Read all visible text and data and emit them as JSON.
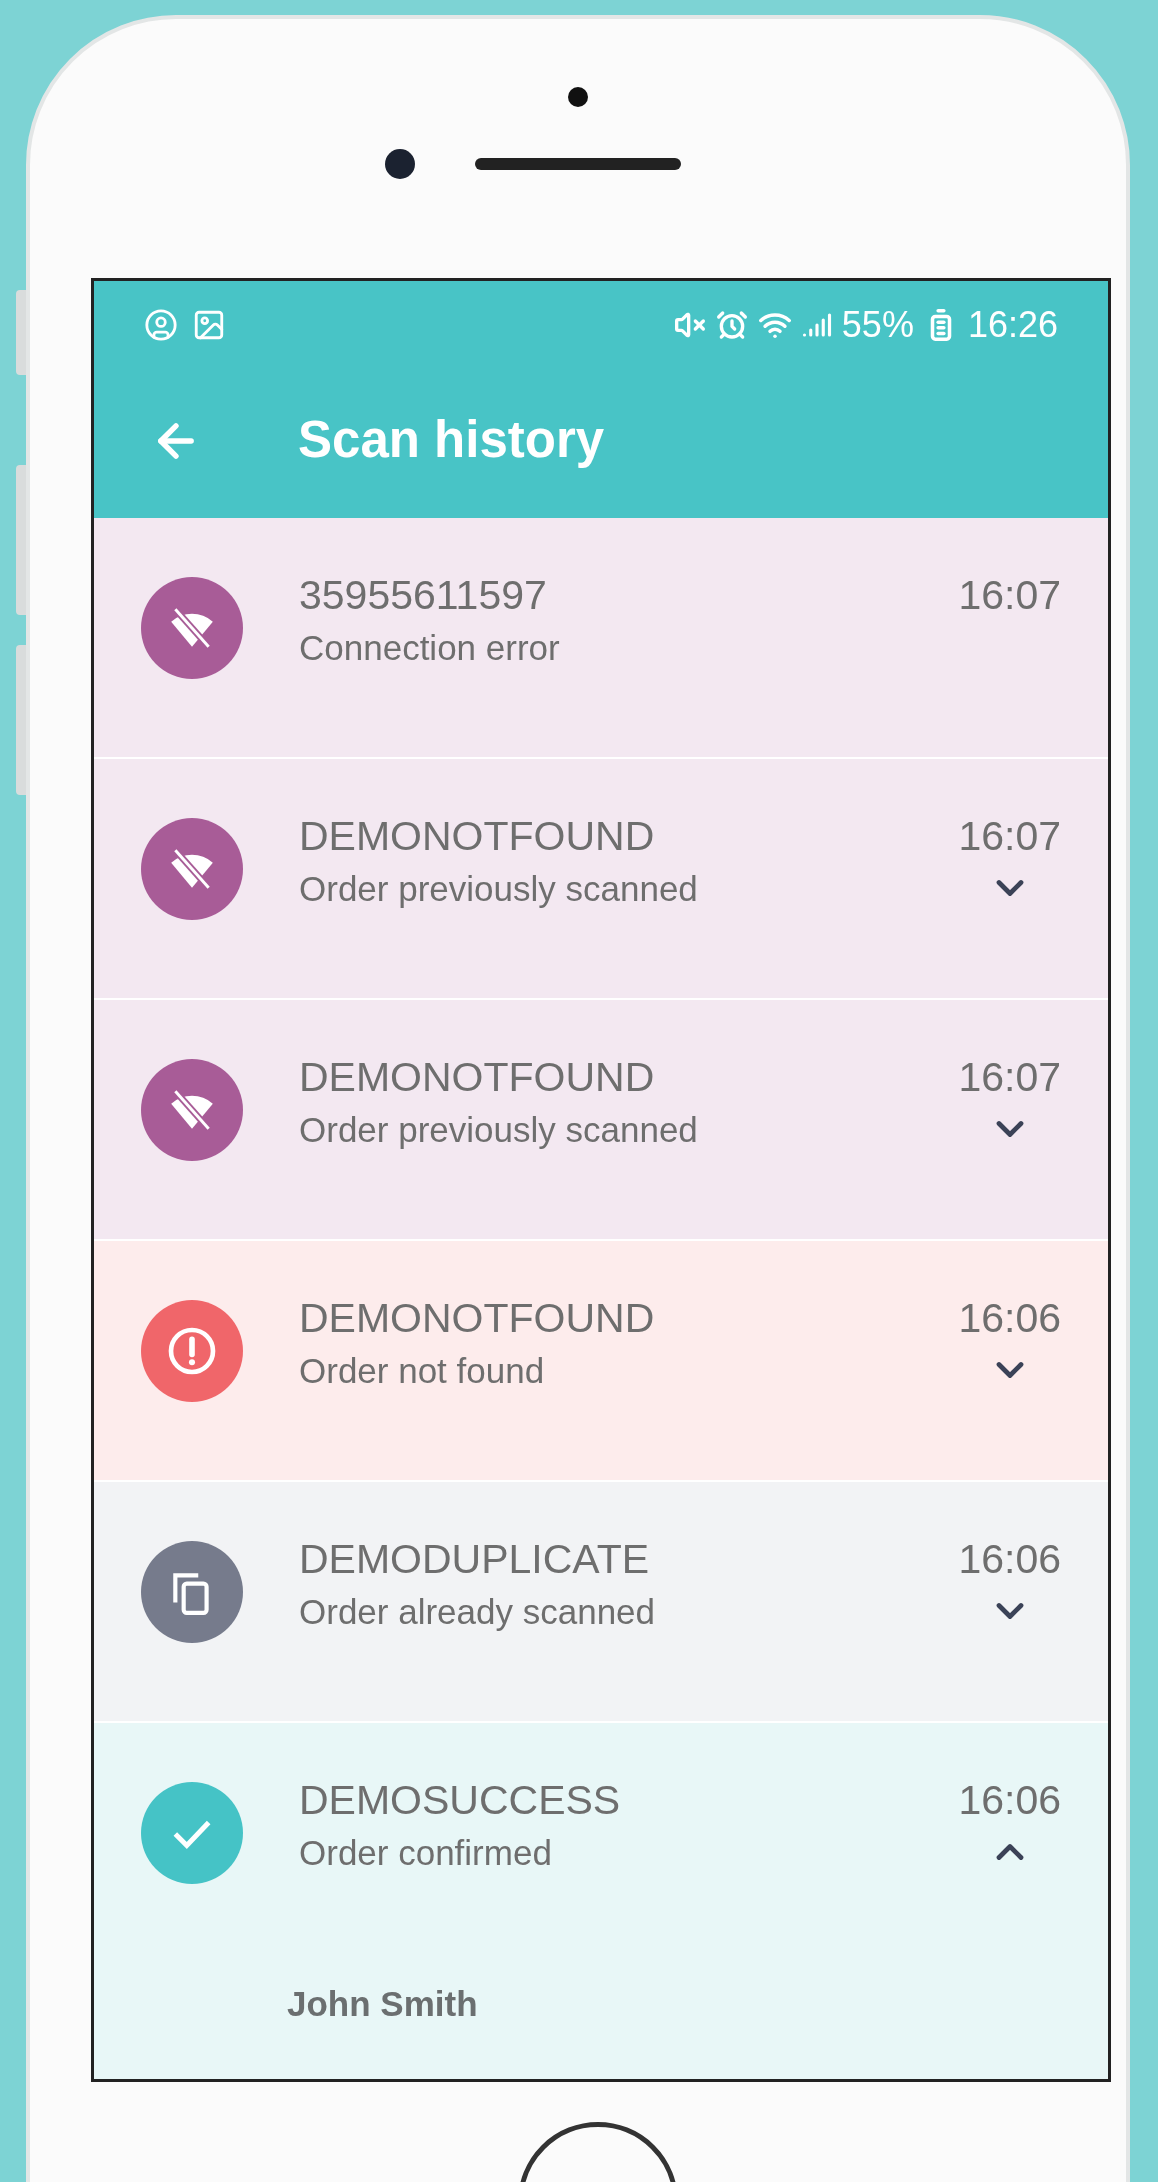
{
  "status_bar": {
    "battery": "55%",
    "time": "16:26"
  },
  "app_bar": {
    "title": "Scan history"
  },
  "rows": [
    {
      "kind": "connection",
      "code": "35955611597",
      "status": "Connection error",
      "time": "16:07"
    },
    {
      "kind": "connection",
      "code": "DEMONOTFOUND",
      "status": "Order previously scanned",
      "time": "16:07",
      "expanded": false
    },
    {
      "kind": "connection",
      "code": "DEMONOTFOUND",
      "status": "Order previously scanned",
      "time": "16:07",
      "expanded": false
    },
    {
      "kind": "error",
      "code": "DEMONOTFOUND",
      "status": "Order not found",
      "time": "16:06",
      "expanded": false
    },
    {
      "kind": "duplicate",
      "code": "DEMODUPLICATE",
      "status": "Order already scanned",
      "time": "16:06",
      "expanded": false
    },
    {
      "kind": "success",
      "code": "DEMOSUCCESS",
      "status": "Order confirmed",
      "time": "16:06",
      "expanded": true,
      "detail": "John Smith"
    }
  ]
}
